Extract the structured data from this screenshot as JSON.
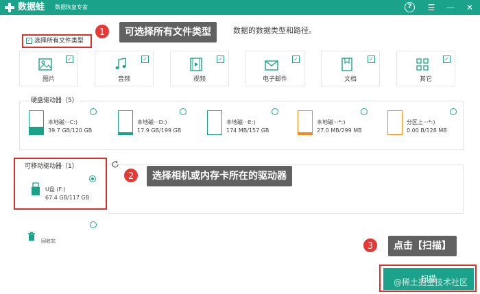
{
  "titlebar": {
    "app_name": "数据蛙",
    "subtitle": "数据恢复专家",
    "help_icon": "question-circle-icon",
    "menu_icon": "hamburger-menu-icon",
    "minimize_icon": "minimize-icon",
    "close_icon": "close-icon"
  },
  "hint_text": "数据的数据类型和路径。",
  "select_all": {
    "label": "选择所有文件类型",
    "checked": true
  },
  "file_types": [
    {
      "label": "图片",
      "icon": "image-icon",
      "checked": true
    },
    {
      "label": "音频",
      "icon": "music-note-icon",
      "checked": true
    },
    {
      "label": "视频",
      "icon": "video-icon",
      "checked": true
    },
    {
      "label": "电子邮件",
      "icon": "envelope-icon",
      "checked": true
    },
    {
      "label": "文档",
      "icon": "document-icon",
      "checked": true
    },
    {
      "label": "其它",
      "icon": "grid-icon",
      "checked": true
    }
  ],
  "hard_drives": {
    "title": "硬盘驱动器（5）",
    "items": [
      {
        "name": "本地磁···C:)",
        "size": "39.7 GB/120 GB",
        "fill_fraction": 0.33,
        "color": "#1aa38a"
      },
      {
        "name": "本地磁···D:)",
        "size": "17.9 GB/199 GB",
        "fill_fraction": 0.09,
        "color": "#1aa38a"
      },
      {
        "name": "本地磁···E:)",
        "size": "174 MB/157 GB",
        "fill_fraction": 0.0,
        "color": "#1aa38a"
      },
      {
        "name": "本地磁···*:)",
        "size": "27.0 MB/299 MB",
        "fill_fraction": 0.09,
        "color": "#f08c1a"
      },
      {
        "name": "分区上···*:)",
        "size": "0.00  B/128 MB",
        "fill_fraction": 0.0,
        "color": "#f08c1a"
      }
    ]
  },
  "removable": {
    "title": "可移动驱动器（1）",
    "refresh_icon": "refresh-icon",
    "drive": {
      "name": "U盘 (F:)",
      "size": "67.4 GB/117 GB",
      "icon": "usb-drive-icon",
      "selected": true
    }
  },
  "recycle_bin": {
    "label": "回收站",
    "icon": "trash-icon"
  },
  "scan_button": {
    "label": "扫描"
  },
  "callouts": [
    {
      "number": "1",
      "text": "可选择所有文件类型"
    },
    {
      "number": "2",
      "text": "选择相机或内存卡所在的驱动器"
    },
    {
      "number": "3",
      "text": "点击【扫描】"
    }
  ],
  "watermark": "@稀土掘金技术社区",
  "colors": {
    "accent": "#1aa38a",
    "highlight": "#d9302a",
    "warning": "#f08c1a",
    "callout_bg": "#616161",
    "callout_badge": "#e53935"
  }
}
